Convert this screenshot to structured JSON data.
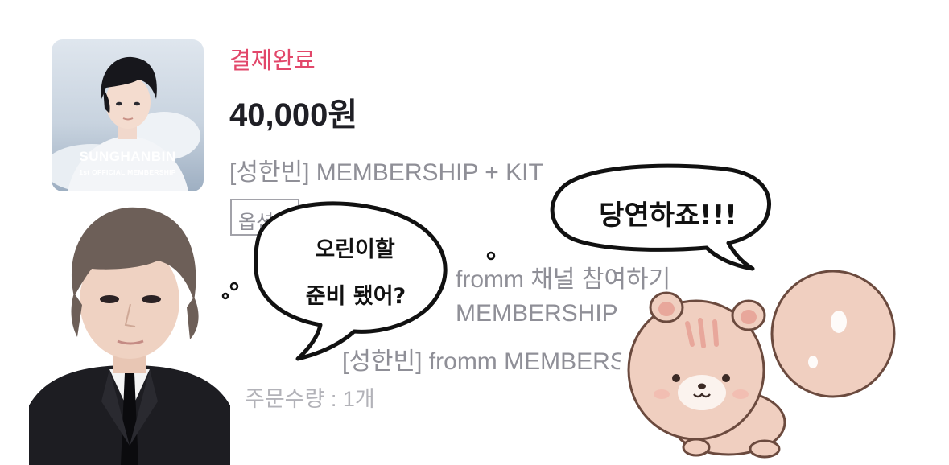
{
  "order": {
    "thumbnail": {
      "title": "SUNGHANBIN",
      "subtitle": "1st OFFICIAL MEMBERSHIP"
    },
    "status": "결제완료",
    "price": "40,000원",
    "product_name": "[성한빈] MEMBERSHIP + KIT",
    "option_badge": "옵션",
    "option_lines": [
      "fromm 채널 참여하기",
      "MEMBERSHIP",
      "[성한빈] fromm MEMBERSHIP"
    ],
    "quantity": "주문수량 : 1개"
  },
  "overlay": {
    "bubble_left_line1": "오린이할",
    "bubble_left_line2": "준비 됐어?",
    "bubble_right": "당연하죠!!!"
  },
  "colors": {
    "status": "#e2476a",
    "price": "#1f1f25",
    "muted_text": "#8f8f97",
    "squirrel_fur": "#f0cfc0",
    "squirrel_stripe": "#e8a79b"
  },
  "icons": {
    "person_photo": "person-photo-icon",
    "squirrel": "squirrel-sticker-icon"
  }
}
